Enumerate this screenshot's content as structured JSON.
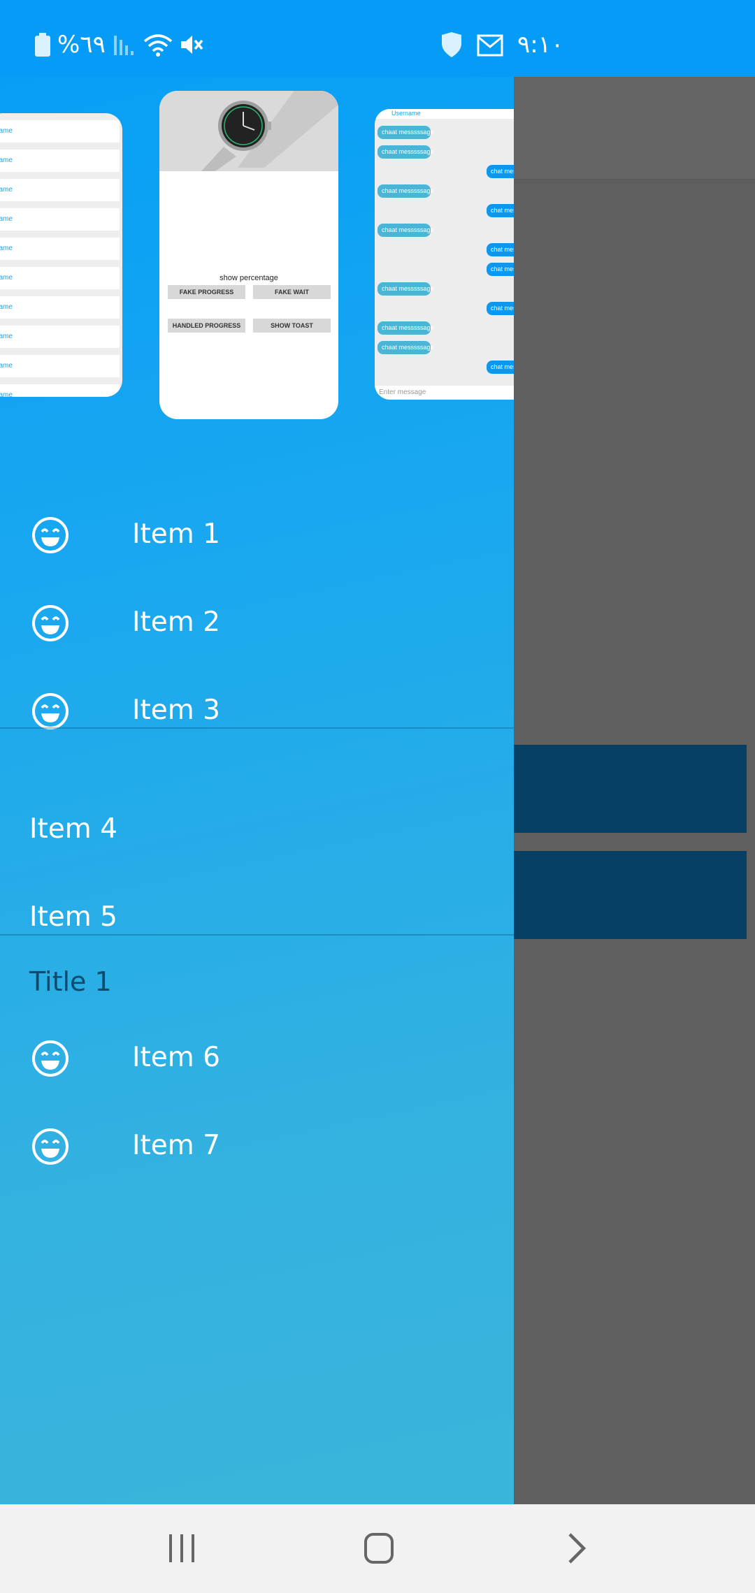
{
  "status_bar": {
    "battery_text": "%٦٩",
    "time": "٩:١٠",
    "icons": [
      "battery-icon",
      "signal-icon",
      "wifi-icon",
      "mute-icon",
      "shield-icon",
      "email-icon"
    ]
  },
  "previews": {
    "list_preview": {
      "rows": [
        "ername",
        "ername",
        "ername",
        "ername",
        "ername",
        "ername",
        "ername",
        "ername",
        "ername",
        "ername"
      ]
    },
    "progress_preview": {
      "show_percentage": "show percentage",
      "buttons": [
        "FAKE PROGRESS",
        "FAKE WAIT",
        "HANDLED PROGRESS",
        "SHOW TOAST"
      ]
    },
    "chat_preview": {
      "username": "Username",
      "incoming_text": "chaat messsssage",
      "outgoing_text": "chat mes",
      "input_placeholder": "Enter message"
    }
  },
  "drawer": {
    "group1": [
      {
        "label": "Item 1",
        "icon": "smile-icon"
      },
      {
        "label": "Item 2",
        "icon": "smile-icon"
      },
      {
        "label": "Item 3",
        "icon": "smile-icon"
      }
    ],
    "group2": [
      {
        "label": "Item 4"
      },
      {
        "label": "Item 5"
      }
    ],
    "section_title": "Title 1",
    "group3": [
      {
        "label": "Item 6",
        "icon": "smile-icon"
      },
      {
        "label": "Item 7",
        "icon": "smile-icon"
      }
    ]
  },
  "nav_bar": {
    "icons": [
      "recents-icon",
      "home-icon",
      "back-icon"
    ]
  },
  "colors": {
    "status_bar": "#049cf6",
    "drawer_top": "#079ff6",
    "drawer_bottom": "#3ab4da",
    "scrim": "#5f5f5f",
    "section_title": "#0c4a6e"
  }
}
